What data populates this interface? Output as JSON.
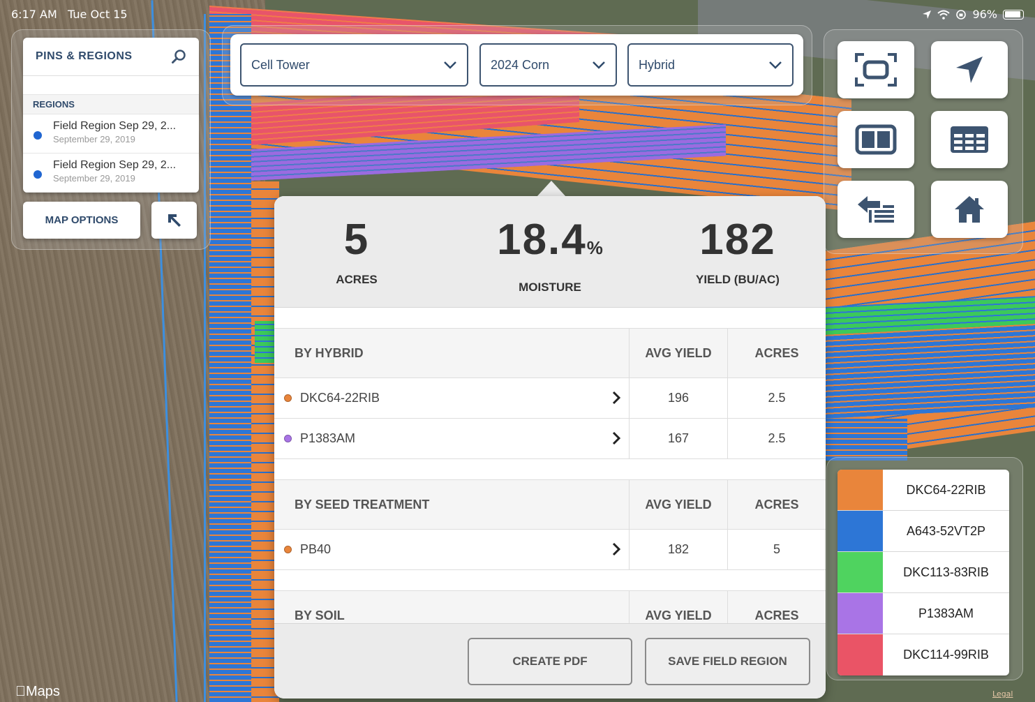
{
  "status_bar": {
    "time": "6:17 AM",
    "date": "Tue Oct 15",
    "battery": "96%"
  },
  "pins_regions": {
    "title": "PINS & REGIONS",
    "section_label": "REGIONS",
    "regions": [
      {
        "title": "Field Region Sep 29, 2...",
        "subtitle": "September 29, 2019"
      },
      {
        "title": "Field Region Sep 29, 2...",
        "subtitle": "September 29, 2019"
      }
    ],
    "map_options_label": "MAP OPTIONS"
  },
  "filters": {
    "field": "Cell Tower",
    "season": "2024 Corn",
    "layer": "Hybrid"
  },
  "summary": {
    "acres_value": "5",
    "acres_label": "ACRES",
    "moisture_value": "18.4",
    "moisture_unit": "%",
    "moisture_label": "MOISTURE",
    "yield_value": "182",
    "yield_label": "YIELD (BU/AC)"
  },
  "tables": {
    "by_hybrid": {
      "header": "BY HYBRID",
      "col2": "AVG YIELD",
      "col3": "ACRES",
      "rows": [
        {
          "name": "DKC64-22RIB",
          "avg_yield": "196",
          "acres": "2.5",
          "color": "#e9853b"
        },
        {
          "name": "P1383AM",
          "avg_yield": "167",
          "acres": "2.5",
          "color": "#a974e6"
        }
      ]
    },
    "by_seed_treatment": {
      "header": "BY SEED TREATMENT",
      "col2": "AVG YIELD",
      "col3": "ACRES",
      "rows": [
        {
          "name": "PB40",
          "avg_yield": "182",
          "acres": "5",
          "color": "#e9853b"
        }
      ]
    },
    "by_soil": {
      "header": "BY SOIL",
      "col2": "AVG YIELD",
      "col3": "ACRES"
    }
  },
  "actions": {
    "create_pdf": "CREATE PDF",
    "save_region": "SAVE FIELD REGION"
  },
  "legend": [
    {
      "label": "DKC64-22RIB",
      "color": "#e9853b"
    },
    {
      "label": "A643-52VT2P",
      "color": "#2d76d6"
    },
    {
      "label": "DKC113-83RIB",
      "color": "#4fd35f"
    },
    {
      "label": "P1383AM",
      "color": "#a974e6"
    },
    {
      "label": "DKC114-99RIB",
      "color": "#ea5466"
    }
  ],
  "map_credit": "Maps",
  "legal": "Legal"
}
